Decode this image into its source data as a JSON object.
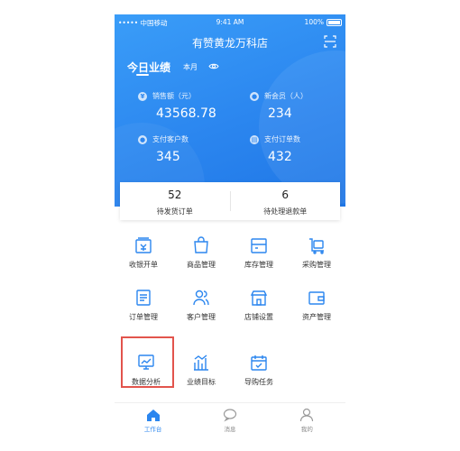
{
  "status_bar": {
    "carrier": "••••• 中国移动 ",
    "time": "9:41 AM",
    "battery": "100%"
  },
  "header": {
    "store_name": "有赞黄龙万科店"
  },
  "performance": {
    "title": "今日业绩",
    "period": "本月",
    "stats": [
      {
        "label": "销售额（元）",
        "value": "43568.78",
        "icon": "yen-icon"
      },
      {
        "label": "新会员（人）",
        "value": "234",
        "icon": "user-icon"
      },
      {
        "label": "支付客户数",
        "value": "345",
        "icon": "user-icon"
      },
      {
        "label": "支付订单数",
        "value": "432",
        "icon": "order-icon"
      }
    ]
  },
  "summary": [
    {
      "value": "52",
      "label": "待发货订单"
    },
    {
      "value": "6",
      "label": "待处理退款单"
    }
  ],
  "menu": [
    {
      "label": "收银开单",
      "icon": "cashier-icon"
    },
    {
      "label": "商品管理",
      "icon": "shopping-bag-icon"
    },
    {
      "label": "库存管理",
      "icon": "inventory-icon"
    },
    {
      "label": "采购管理",
      "icon": "cart-icon"
    },
    {
      "label": "订单管理",
      "icon": "order-list-icon"
    },
    {
      "label": "客户管理",
      "icon": "customers-icon"
    },
    {
      "label": "店铺设置",
      "icon": "store-icon"
    },
    {
      "label": "资产管理",
      "icon": "wallet-icon"
    },
    {
      "label": "数据分析",
      "icon": "chart-icon"
    },
    {
      "label": "业绩目标",
      "icon": "bar-chart-icon"
    },
    {
      "label": "导购任务",
      "icon": "calendar-task-icon"
    }
  ],
  "tabbar": [
    {
      "label": "工作台",
      "icon": "home-icon",
      "active": true
    },
    {
      "label": "消息",
      "icon": "message-icon",
      "active": false
    },
    {
      "label": "我的",
      "icon": "profile-icon",
      "active": false
    }
  ],
  "colors": {
    "primary": "#2b86ef",
    "highlight": "#e2544c",
    "icon_blue": "#2b86ef"
  }
}
